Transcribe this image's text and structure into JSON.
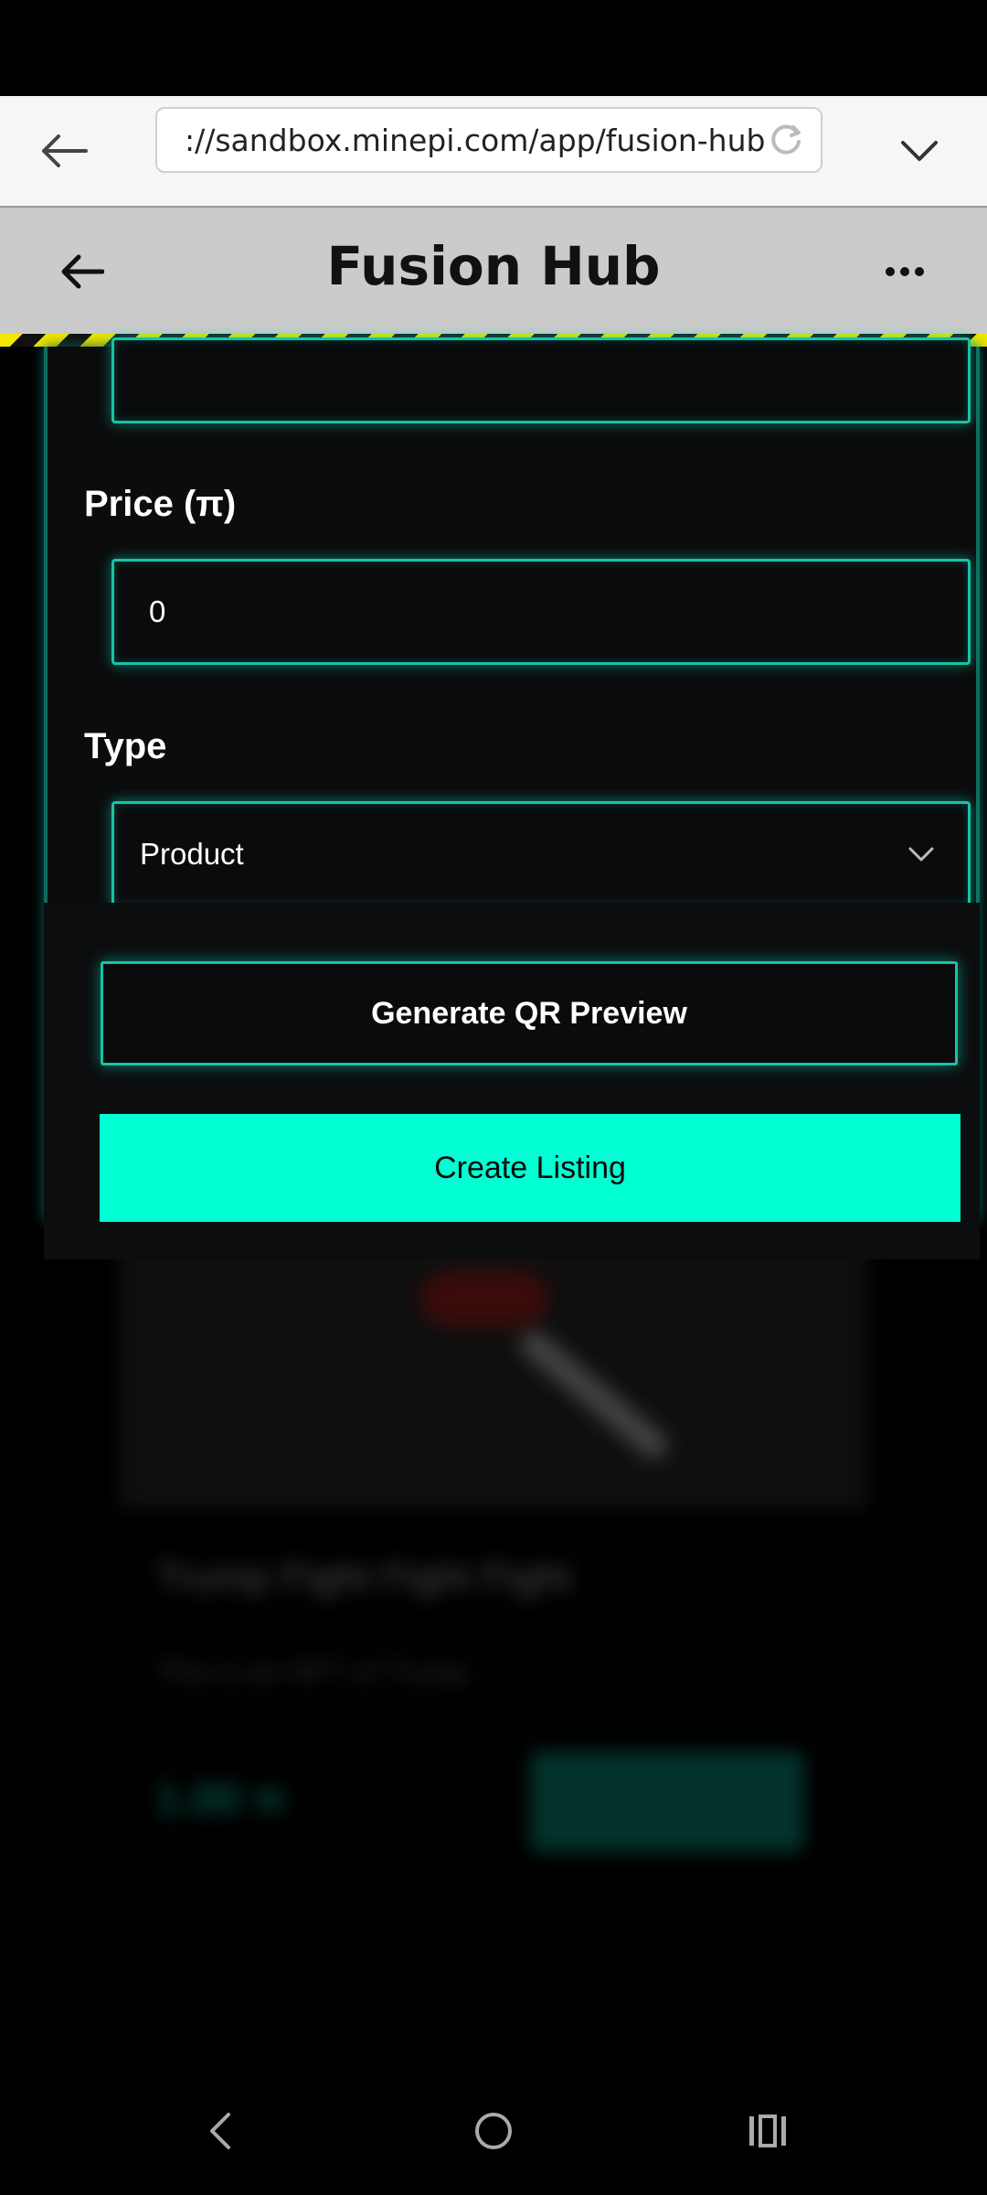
{
  "browser": {
    "url": "://sandbox.minepi.com/app/fusion-hub",
    "icons": [
      "back-arrow-icon",
      "reload-icon",
      "chevron-down-icon"
    ]
  },
  "app": {
    "title": "Fusion Hub",
    "icons": [
      "back-arrow-icon",
      "more-options-icon"
    ]
  },
  "form": {
    "price_label": "Price (π)",
    "price_value": "0",
    "type_label": "Type",
    "type_value": "Product",
    "generate_button": "Generate QR Preview",
    "create_button": "Create Listing"
  },
  "background_listing": {
    "title": "Trump Fight Fight Fight",
    "description": "This is an NFT of Trump",
    "price": "1.00 π"
  },
  "colors": {
    "accent": "#00ffd2",
    "field_border": "#18c2a6",
    "hazard_yellow": "#f3e600",
    "header_bg": "#cbcbcb"
  }
}
